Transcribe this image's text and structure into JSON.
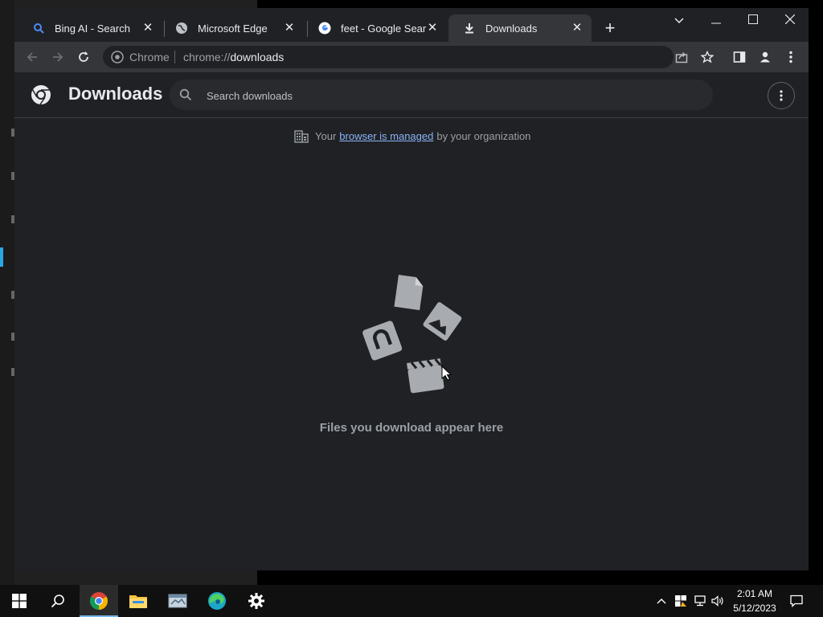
{
  "tabs": [
    {
      "label": "Bing AI - Search",
      "icon": "bing-search-icon"
    },
    {
      "label": "Microsoft Edge",
      "icon": "globe-icon"
    },
    {
      "label": "feet - Google Search",
      "icon": "google-icon"
    },
    {
      "label": "Downloads",
      "icon": "download-icon",
      "active": true
    }
  ],
  "omnibox": {
    "label": "Chrome",
    "scheme": "chrome://",
    "host": "downloads"
  },
  "page": {
    "title": "Downloads",
    "search_placeholder": "Search downloads",
    "managed_prefix": "Your",
    "managed_link": "browser is managed",
    "managed_suffix": "by your organization",
    "empty_message": "Files you download appear here"
  },
  "taskbar": {
    "time": "2:01 AM",
    "date": "5/12/2023"
  },
  "colors": {
    "accent": "#8ab4f8",
    "background": "#202124",
    "toolbar": "#35363a"
  }
}
